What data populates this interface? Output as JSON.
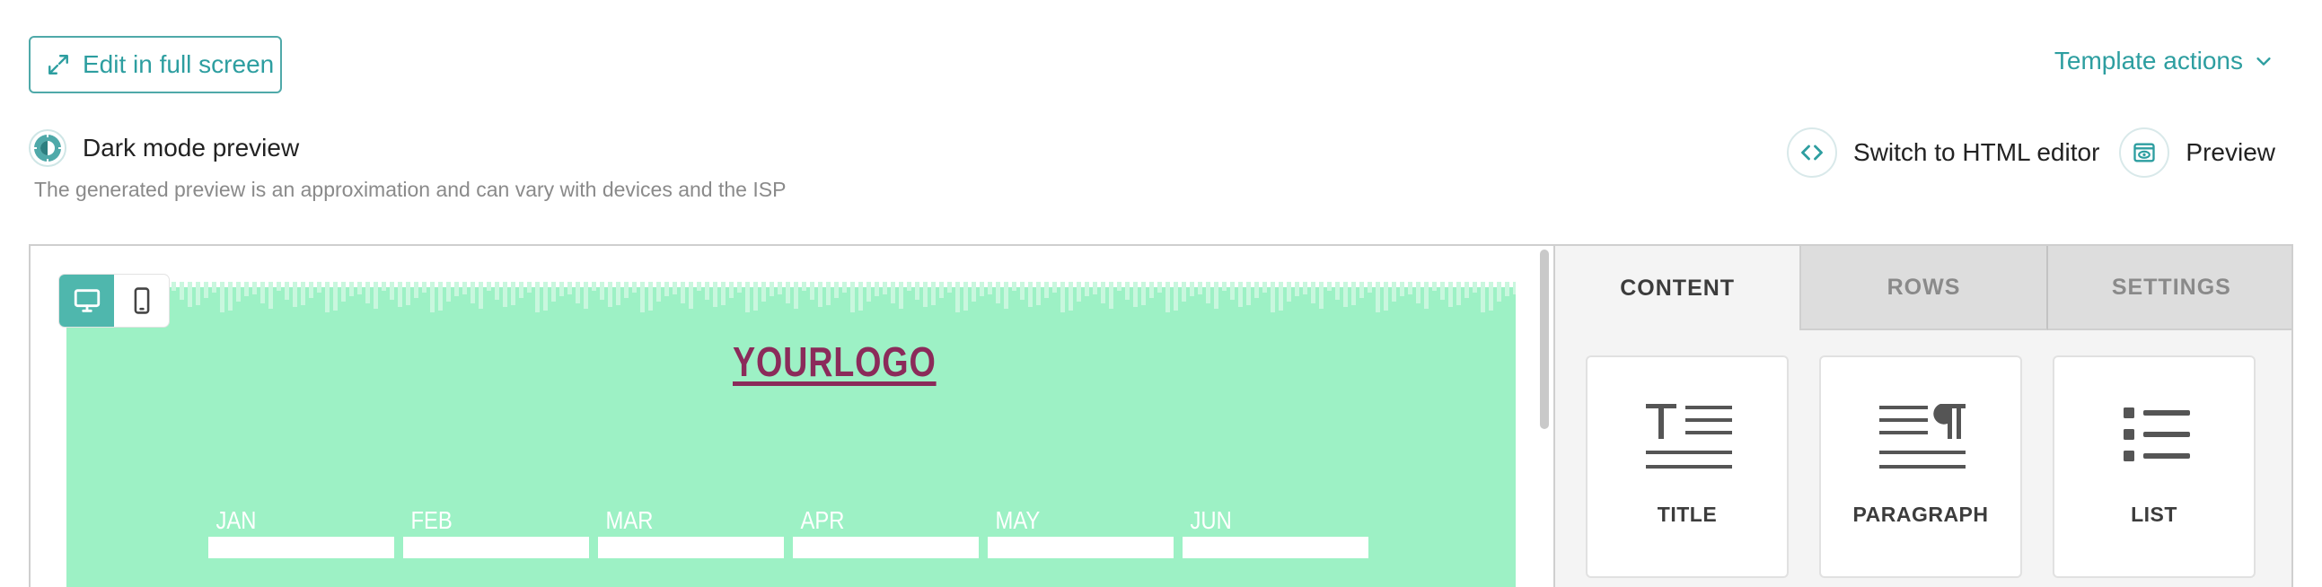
{
  "toolbar": {
    "edit_fullscreen_label": "Edit in full screen",
    "template_actions_label": "Template actions"
  },
  "dark_mode": {
    "label": "Dark mode preview",
    "note": "The generated preview is an approximation and can vary with devices and the ISP"
  },
  "actions": {
    "html_editor_label": "Switch to HTML editor",
    "preview_label": "Preview"
  },
  "email": {
    "logo_text": "YOURLOGO",
    "background_color": "#9df1c5",
    "logo_color": "#8b2b5a",
    "months": [
      "JAN",
      "FEB",
      "MAR",
      "APR",
      "MAY",
      "JUN"
    ]
  },
  "device_toggle": {
    "active": "desktop"
  },
  "sidebar": {
    "tabs": [
      {
        "label": "CONTENT",
        "active": true
      },
      {
        "label": "ROWS",
        "active": false
      },
      {
        "label": "SETTINGS",
        "active": false
      }
    ],
    "blocks": [
      {
        "label": "TITLE",
        "icon": "title-icon"
      },
      {
        "label": "PARAGRAPH",
        "icon": "paragraph-icon"
      },
      {
        "label": "LIST",
        "icon": "list-icon"
      }
    ]
  },
  "colors": {
    "accent": "#2d9ea0",
    "toggle_active": "#4fb7ad"
  }
}
